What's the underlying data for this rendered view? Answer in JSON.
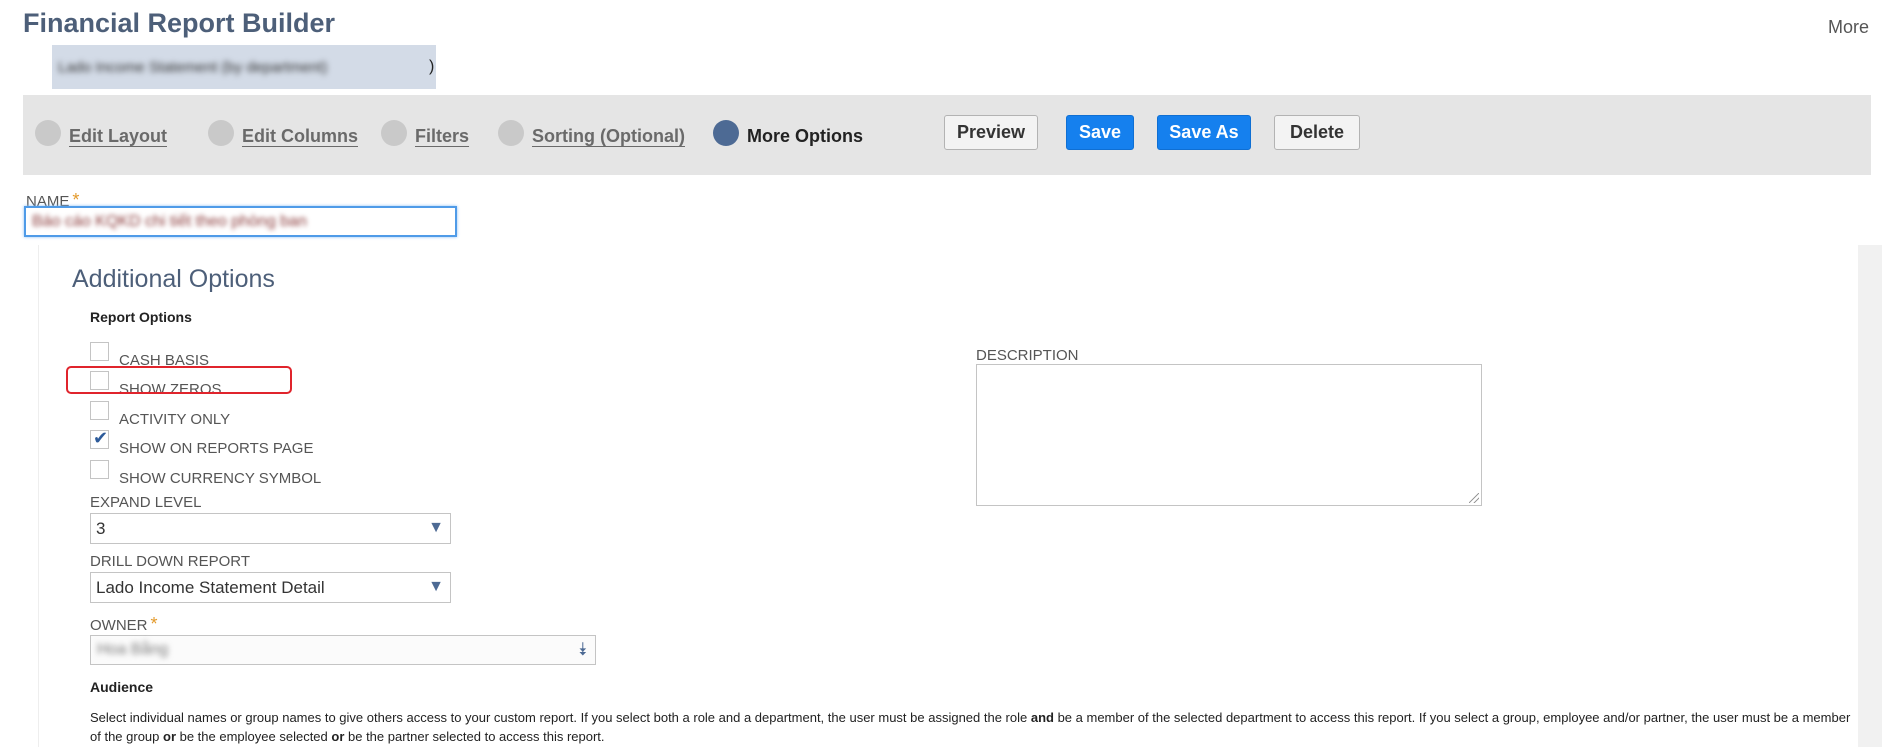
{
  "header": {
    "title": "Financial Report Builder",
    "more_label": "More",
    "subtitle_blurred": "Lado Income Statement (by department)",
    "subtitle_suffix": ")"
  },
  "steps": [
    {
      "label": "Edit Layout",
      "active": false
    },
    {
      "label": "Edit Columns",
      "active": false
    },
    {
      "label": "Filters",
      "active": false
    },
    {
      "label": "Sorting (Optional)",
      "active": false
    },
    {
      "label": "More Options",
      "active": true
    }
  ],
  "buttons": {
    "preview": "Preview",
    "save": "Save",
    "save_as": "Save As",
    "delete": "Delete"
  },
  "name_field": {
    "label": "NAME",
    "required_mark": "*",
    "value_blurred": "Báo cáo KQKD chi tiết theo phòng ban"
  },
  "section_title": "Additional Options",
  "report_options": {
    "title": "Report Options",
    "checkboxes": [
      {
        "label": "CASH BASIS",
        "checked": false
      },
      {
        "label": "SHOW ZEROS",
        "checked": false
      },
      {
        "label": "ACTIVITY ONLY",
        "checked": false
      },
      {
        "label": "SHOW ON REPORTS PAGE",
        "checked": true
      },
      {
        "label": "SHOW CURRENCY SYMBOL",
        "checked": false
      }
    ],
    "check_glyph": "✔"
  },
  "expand_level": {
    "label": "EXPAND LEVEL",
    "value": "3"
  },
  "drill_down": {
    "label": "DRILL DOWN REPORT",
    "value": "Lado Income Statement Detail"
  },
  "owner": {
    "label": "OWNER",
    "required_mark": "*",
    "value_blurred": "Hoa Bằng"
  },
  "description": {
    "label": "DESCRIPTION",
    "value": ""
  },
  "audience": {
    "title": "Audience",
    "text_1": "Select individual names or group names to give others access to your custom report. If you select both a role and a department, the user must be assigned the role ",
    "bold_1": "and",
    "text_2": " be a member of the selected department to access this report. If you select a group, employee and/or partner, the user must be a member of the group ",
    "bold_2": "or",
    "text_3": " be the employee selected ",
    "bold_3": "or",
    "text_4": " be the partner selected to access this report."
  },
  "icons": {
    "dropdown_arrow": "▼",
    "double_chevron": "⯯"
  },
  "colors": {
    "title": "#4d5f79",
    "primary_button": "#1580ee",
    "active_step": "#4d6a94",
    "highlight_box": "#e0242c"
  }
}
